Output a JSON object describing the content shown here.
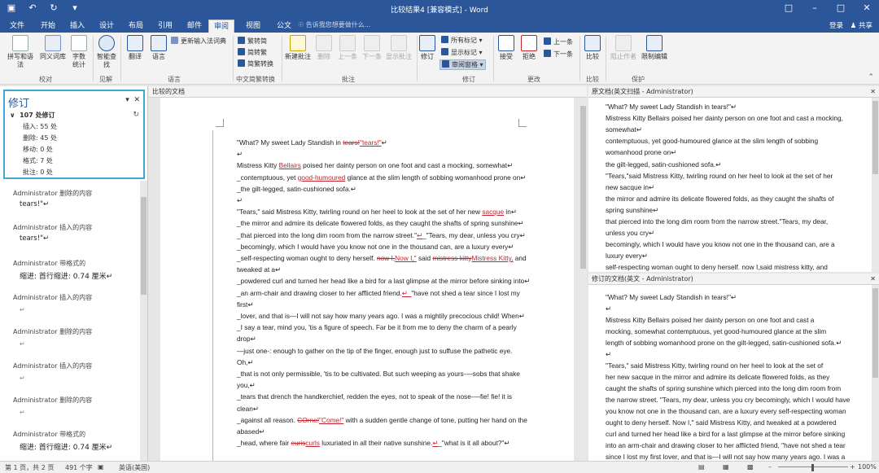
{
  "window": {
    "title": "比较结果4 [兼容模式] - Word"
  },
  "tabs": [
    "文件",
    "开始",
    "插入",
    "设计",
    "布局",
    "引用",
    "邮件",
    "审阅",
    "视图",
    "公文"
  ],
  "tellme": "告诉我您想要做什么...",
  "account": {
    "login": "登录",
    "share": "共享"
  },
  "ribbon": {
    "proofing": {
      "spelling": "拼写和语法",
      "thesaurus": "同义词库",
      "wordcount": "字数统计",
      "group": "校对"
    },
    "insights": {
      "smart_lookup": "智能查找",
      "group": "见解"
    },
    "language": {
      "translate": "翻译",
      "language": "语言",
      "update_ime": "更新输入法词典",
      "group": "语言"
    },
    "chinese": {
      "to_simplified": "繁转简",
      "to_traditional": "简转繁",
      "convert": "简繁转换",
      "group": "中文简繁转换"
    },
    "comments": {
      "new": "新建批注",
      "delete": "删除",
      "prev": "上一条",
      "next": "下一条",
      "show": "显示批注",
      "group": "批注"
    },
    "tracking": {
      "track": "修订",
      "markup": "所有标记",
      "show_markup": "显示标记",
      "reviewing_pane": "审阅窗格",
      "group": "修订"
    },
    "changes": {
      "accept": "接受",
      "reject": "拒绝",
      "prev": "上一条",
      "next": "下一条",
      "group": "更改"
    },
    "compare": {
      "compare": "比较",
      "group": "比较"
    },
    "protect": {
      "block_authors": "阻止作者",
      "restrict": "限制编辑",
      "group": "保护"
    }
  },
  "revisions": {
    "title": "修订",
    "summary": "107 处修订",
    "stats": [
      "插入: 55 处",
      "删除: 45 处",
      "移动: 0 处",
      "格式: 7 处",
      "批注: 0 处"
    ],
    "items": [
      {
        "author": "Administrator 删除的内容",
        "text": "tears!\"↵"
      },
      {
        "author": "Administrator 插入的内容",
        "text": "tears!\"↵"
      },
      {
        "author": "Administrator 带格式的",
        "text": "缩进: 首行缩进:   0.74  厘米↵"
      },
      {
        "author": "Administrator 插入的内容",
        "text": "↵"
      },
      {
        "author": "Administrator 删除的内容",
        "text": "↵"
      },
      {
        "author": "Administrator 插入的内容",
        "text": "↵"
      },
      {
        "author": "Administrator 删除的内容",
        "text": "↵"
      },
      {
        "author": "Administrator 带格式的",
        "text": "缩进: 首行缩进:   0.74  厘米↵"
      }
    ]
  },
  "compared": {
    "header": "比较的文档",
    "lines": [
      [
        {
          "t": "\"What? My sweet Lady Standish in "
        },
        {
          "t": "tears!",
          "c": "del"
        },
        {
          "t": "\"tears!\"",
          "c": "ins"
        },
        {
          "t": "↵"
        }
      ],
      [
        {
          "t": "↵"
        }
      ],
      [
        {
          "t": "Mistress Kitty "
        },
        {
          "t": "Bellairs",
          "c": "ins"
        },
        {
          "t": " poised her dainty person on one foot and cast a mocking, somewhat↵"
        }
      ],
      [
        {
          "t": "_contemptuous, yet "
        },
        {
          "t": "good-humoured",
          "c": "ins"
        },
        {
          "t": " glance at the slim length of sobbing womanhood prone on↵"
        }
      ],
      [
        {
          "t": "    _the gilt-legged, satin-cushioned sofa.↵"
        }
      ],
      [
        {
          "t": "↵"
        }
      ],
      [
        {
          "t": "\"Tears,\" said Mistress Kitty, twirling round on her heel to look at the set of her new "
        },
        {
          "t": "sacque",
          "c": "ins"
        },
        {
          "t": " in↵"
        }
      ],
      [
        {
          "t": "_the mirror and admire its delicate flowered folds, as they caught the shafts of spring sunshine↵"
        }
      ],
      [
        {
          "t": "_that pierced into the long dim room from the narrow street.\""
        },
        {
          "t": "↵",
          "c": "ins"
        },
        {
          "t": "_\"Tears, my dear, unless you cry↵"
        }
      ],
      [
        {
          "t": "_becomingly, which I would have you know not one in the thousand can, are a luxury every↵"
        }
      ],
      [
        {
          "t": "_self-respecting woman ought to deny herself. "
        },
        {
          "t": "now I,",
          "c": "del"
        },
        {
          "t": "Now I,\"",
          "c": "ins"
        },
        {
          "t": " said "
        },
        {
          "t": "mistress kitty",
          "c": "del"
        },
        {
          "t": "Mistress Kitty,",
          "c": "ins"
        },
        {
          "t": " and"
        }
      ],
      [
        {
          "t": "tweaked at a↵"
        }
      ],
      [
        {
          "t": "_powdered curl and turned her head like a bird for a last glimpse at the mirror before sinking into↵"
        }
      ],
      [
        {
          "t": "_an arm-chair and drawing closer to her afflicted friend."
        },
        {
          "t": "↵_",
          "c": "ins"
        },
        {
          "t": "\"have not shed a tear since I lost my"
        }
      ],
      [
        {
          "t": "first↵"
        }
      ],
      [
        {
          "t": "_lover, and that is—I will not say how many years ago. I was a mightily precocious child! When↵"
        }
      ],
      [
        {
          "t": "_I say a tear, mind you, 'tis a figure of speech. Far be it from me to deny the charm of a pearly"
        }
      ],
      [
        {
          "t": "drop↵"
        }
      ],
      [
        {
          "t": "—just one-: enough to gather on the tip of the finger, enough just to suffuse the pathetic eye."
        }
      ],
      [
        {
          "t": "Oh,↵"
        }
      ],
      [
        {
          "t": "_that is not only permissible, 'tis to be cultivated. But such weeping as yours-—sobs that shake"
        }
      ],
      [
        {
          "t": "you,↵"
        }
      ],
      [
        {
          "t": "_tears that drench the handkerchief, redden the eyes, not to speak of the nose-—fie! fie! it is"
        }
      ],
      [
        {
          "t": "clean↵"
        }
      ],
      [
        {
          "t": "_against all reason. "
        },
        {
          "t": "COrne!",
          "c": "del"
        },
        {
          "t": "\"Come!\"",
          "c": "ins"
        },
        {
          "t": " with a sudden gentle change of tone, putting her hand on the"
        }
      ],
      [
        {
          "t": "abased↵"
        }
      ],
      [
        {
          "t": "    _head, where fair "
        },
        {
          "t": "euris",
          "c": "del"
        },
        {
          "t": "curls",
          "c": "ins"
        },
        {
          "t": " luxuriated in all their native sunshine."
        },
        {
          "t": "↵",
          "c": "ins"
        },
        {
          "t": "_\"what is it all about?\"↵"
        }
      ]
    ]
  },
  "original": {
    "header": "原文档(英文扫描 - Administrator)",
    "lines": [
      "\"What? My sweet Lady Standish in tears!\"↵",
      "Mistress Kitty Bellairs poised her dainty person on one foot and cast a mocking,",
      "somewhat↵",
      "contemptuous, yet good-humoured glance at the slim length of sobbing",
      "womanhood prone on↵",
      "the gilt-legged, satin-cushioned sofa.↵",
      "\"Tears,\"said Mistress Kitty, twirling round on her heel to look at the set of her",
      "new sacque in↵",
      "the mirror and admire its delicate flowered folds, as they caught the shafts of",
      "spring sunshine↵",
      "that pierced into the long dim room from the narrow street.\"Tears, my dear,",
      "unless you cry↵",
      "becomingly, which I would have you know not one in the thousand can, are a",
      "luxury every↵",
      "self-respecting woman ought to deny herself. now I,said mistress kitty, and"
    ]
  },
  "revised": {
    "header": "修订的文档(英文 - Administrator)",
    "lines": [
      "\"What? My sweet Lady Standish in tears!\"↵",
      "↵",
      "Mistress Kitty Bellairs poised her dainty person on one foot and cast a",
      "mocking, somewhat contemptuous, yet good-humoured glance at the slim",
      "length of sobbing womanhood prone on the gilt-legged, satin-cushioned sofa.↵",
      "↵",
      "\"Tears,\" said Mistress Kitty, twirling round on her heel to look at the set of",
      "her new sacque in the mirror and admire its delicate flowered folds, as they",
      "caught the shafts of spring sunshine which pierced into the long dim room from",
      "the narrow street. \"Tears, my dear, unless you cry becomingly, which I would have",
      "you know not one in the thousand can, are a luxury every self-respecting woman",
      "ought to deny herself. Now I,\" said Mistress Kitty, and tweaked at a powdered",
      "curl and turned her head like a bird for a last glimpse at the mirror before sinking",
      "into an arm-chair and drawing closer to her afflicted friend, \"have not shed a tear",
      "since I lost my first lover, and that is—I will not say how many years ago. I was a"
    ]
  },
  "status": {
    "page": "第 1 页，共 2 页",
    "words": "491 个字",
    "lang": "英语(美国)",
    "zoom": "100%"
  },
  "colors": {
    "accent": "#2b579a",
    "revision_mark": "#c0262d",
    "pane_highlight": "#41a6d6"
  }
}
